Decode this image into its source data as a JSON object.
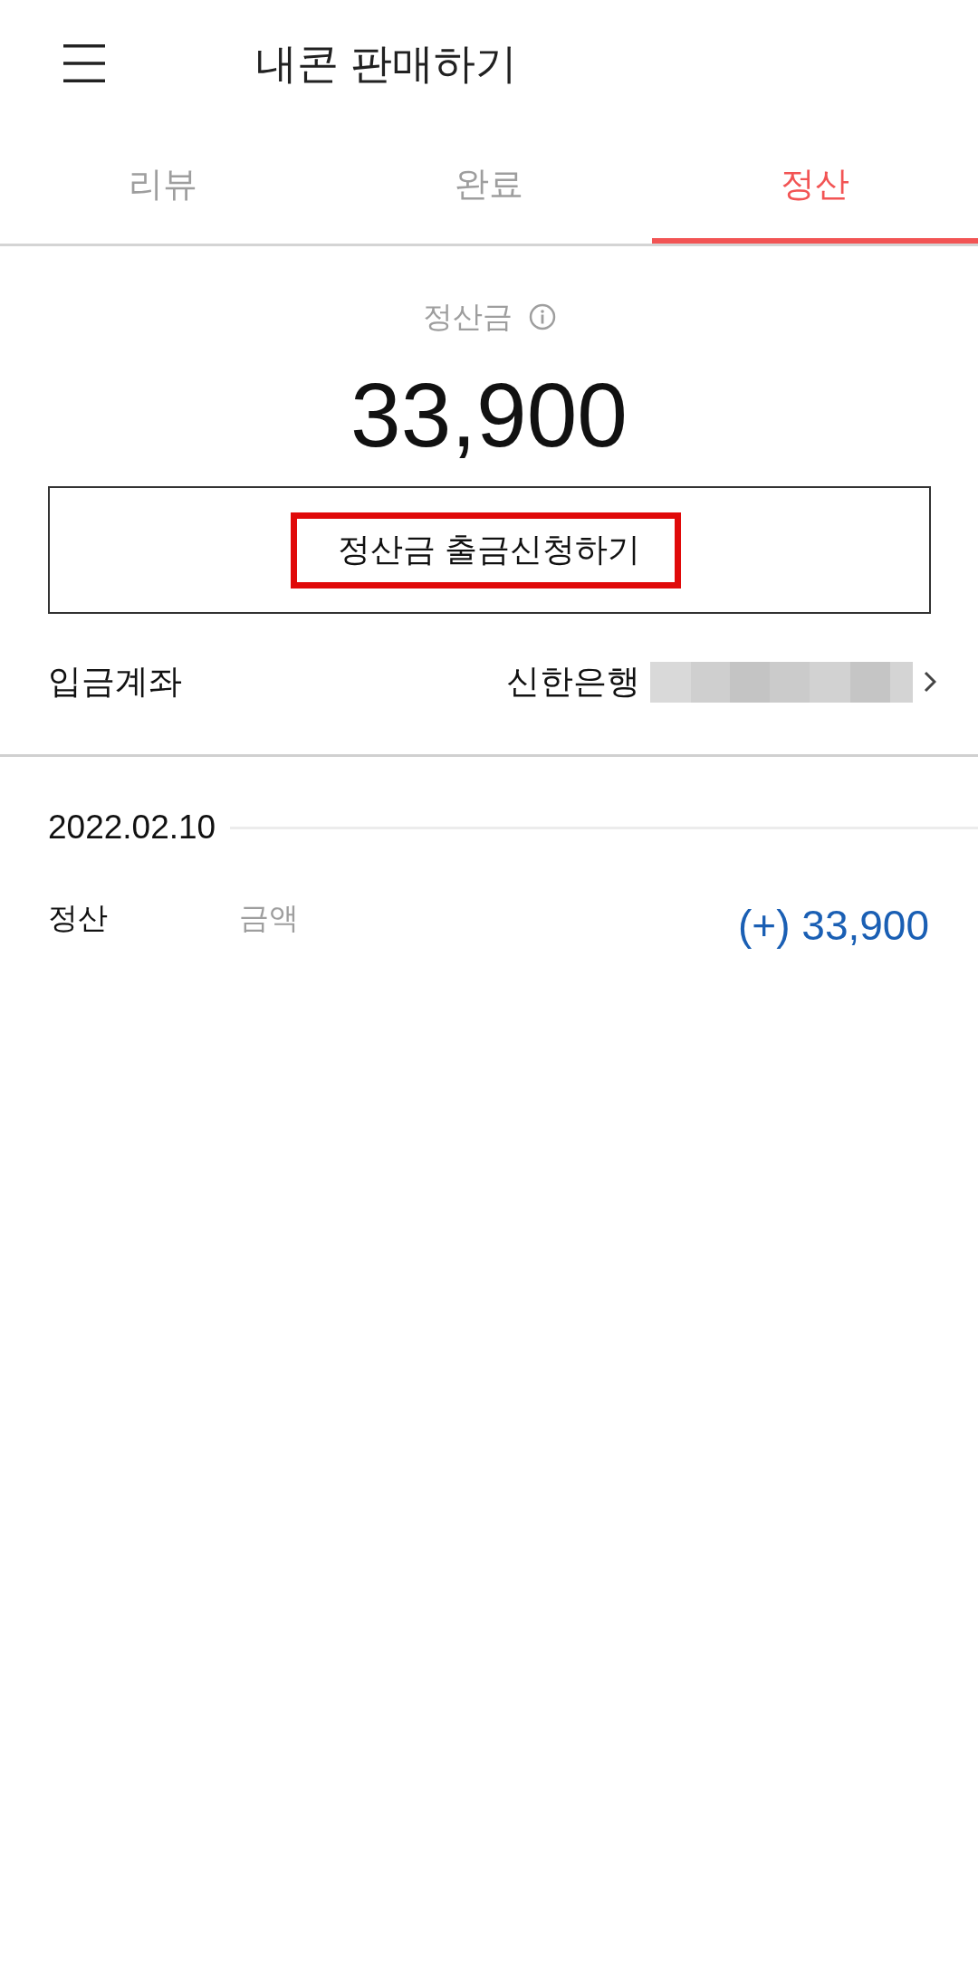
{
  "app_bar": {
    "title": "내콘 판매하기"
  },
  "tabs": [
    {
      "label": "리뷰",
      "selected": false
    },
    {
      "label": "완료",
      "selected": false
    },
    {
      "label": "정산",
      "selected": true
    }
  ],
  "settlement": {
    "label": "정산금",
    "amount": "33,900",
    "withdraw_button": {
      "label": "정산금 출금신청하기",
      "highlighted": true
    }
  },
  "deposit_account": {
    "label": "입금계좌",
    "bank": "신한은행",
    "number_redacted": true
  },
  "history": [
    {
      "date": "2022.02.10",
      "entries": [
        {
          "type": "정산",
          "caption": "금액",
          "amount": "(+) 33,900"
        }
      ]
    }
  ]
}
